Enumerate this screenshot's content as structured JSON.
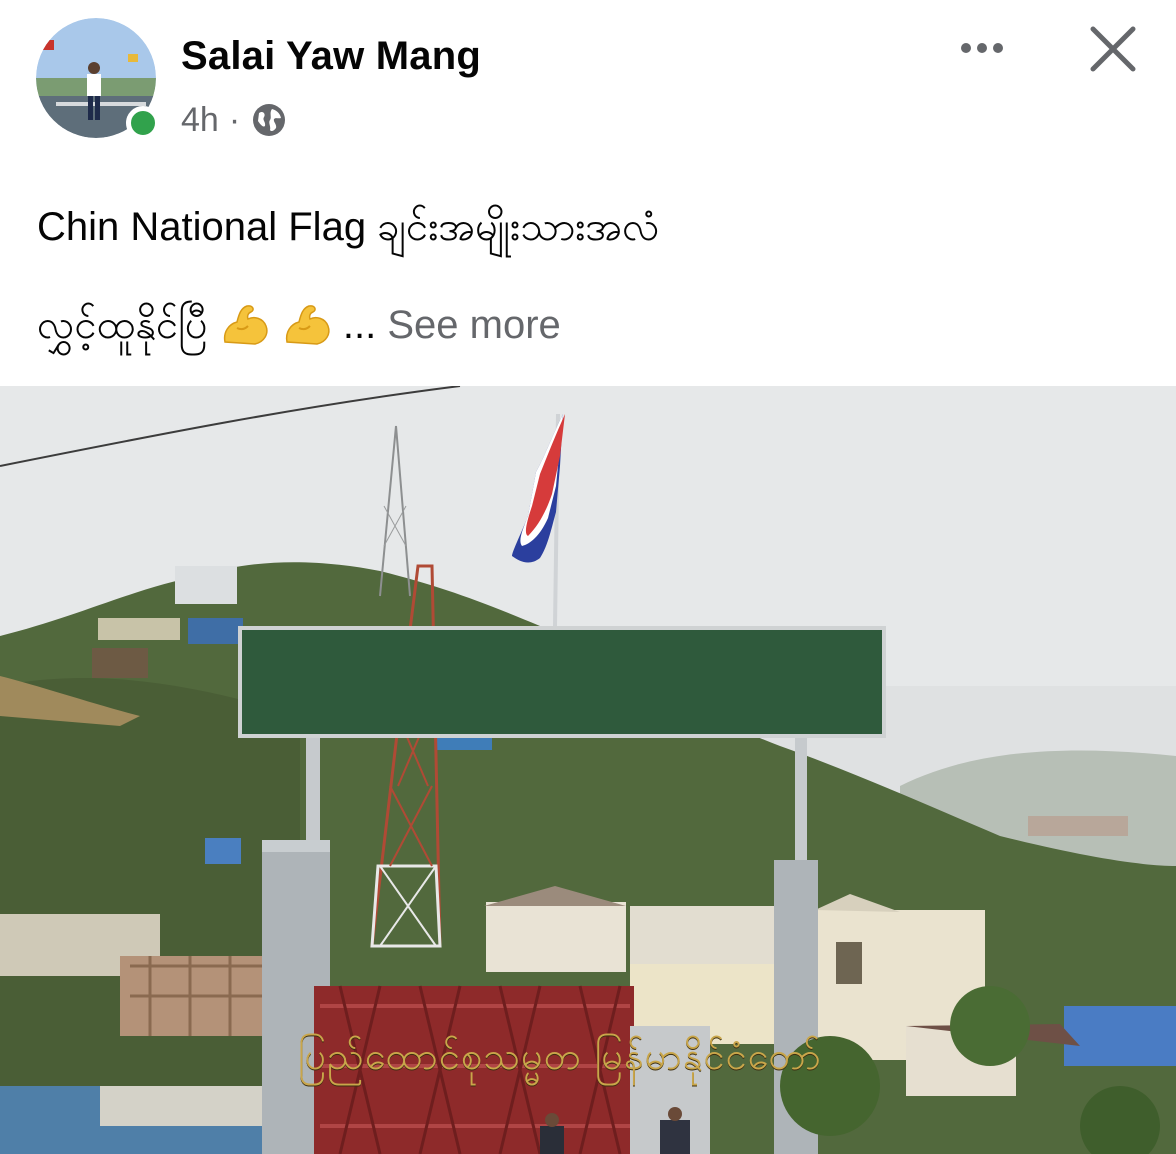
{
  "post": {
    "author": "Salai Yaw Mang",
    "time": "4h",
    "separator": "·",
    "privacy_icon": "globe-icon",
    "author_online": true,
    "text_line1": "Chin National Flag ချင်းအမျိုးသားအလံ",
    "text_line2": "လွှင့်ထူနိုင်ပြီ",
    "emojis": [
      "flexed-biceps-emoji",
      "flexed-biceps-emoji"
    ],
    "ellipsis": "...",
    "see_more": "See more"
  },
  "photo": {
    "sign_text": "ပြည်ထောင်စုသမ္မတ မြန်မာနိုင်ငံတော်",
    "flag_colors": [
      "#d63b3b",
      "#ffffff",
      "#2b3f9e"
    ],
    "sign_color": "#2f5a3c"
  },
  "icons": {
    "more": "more-options-icon",
    "close": "close-icon"
  }
}
